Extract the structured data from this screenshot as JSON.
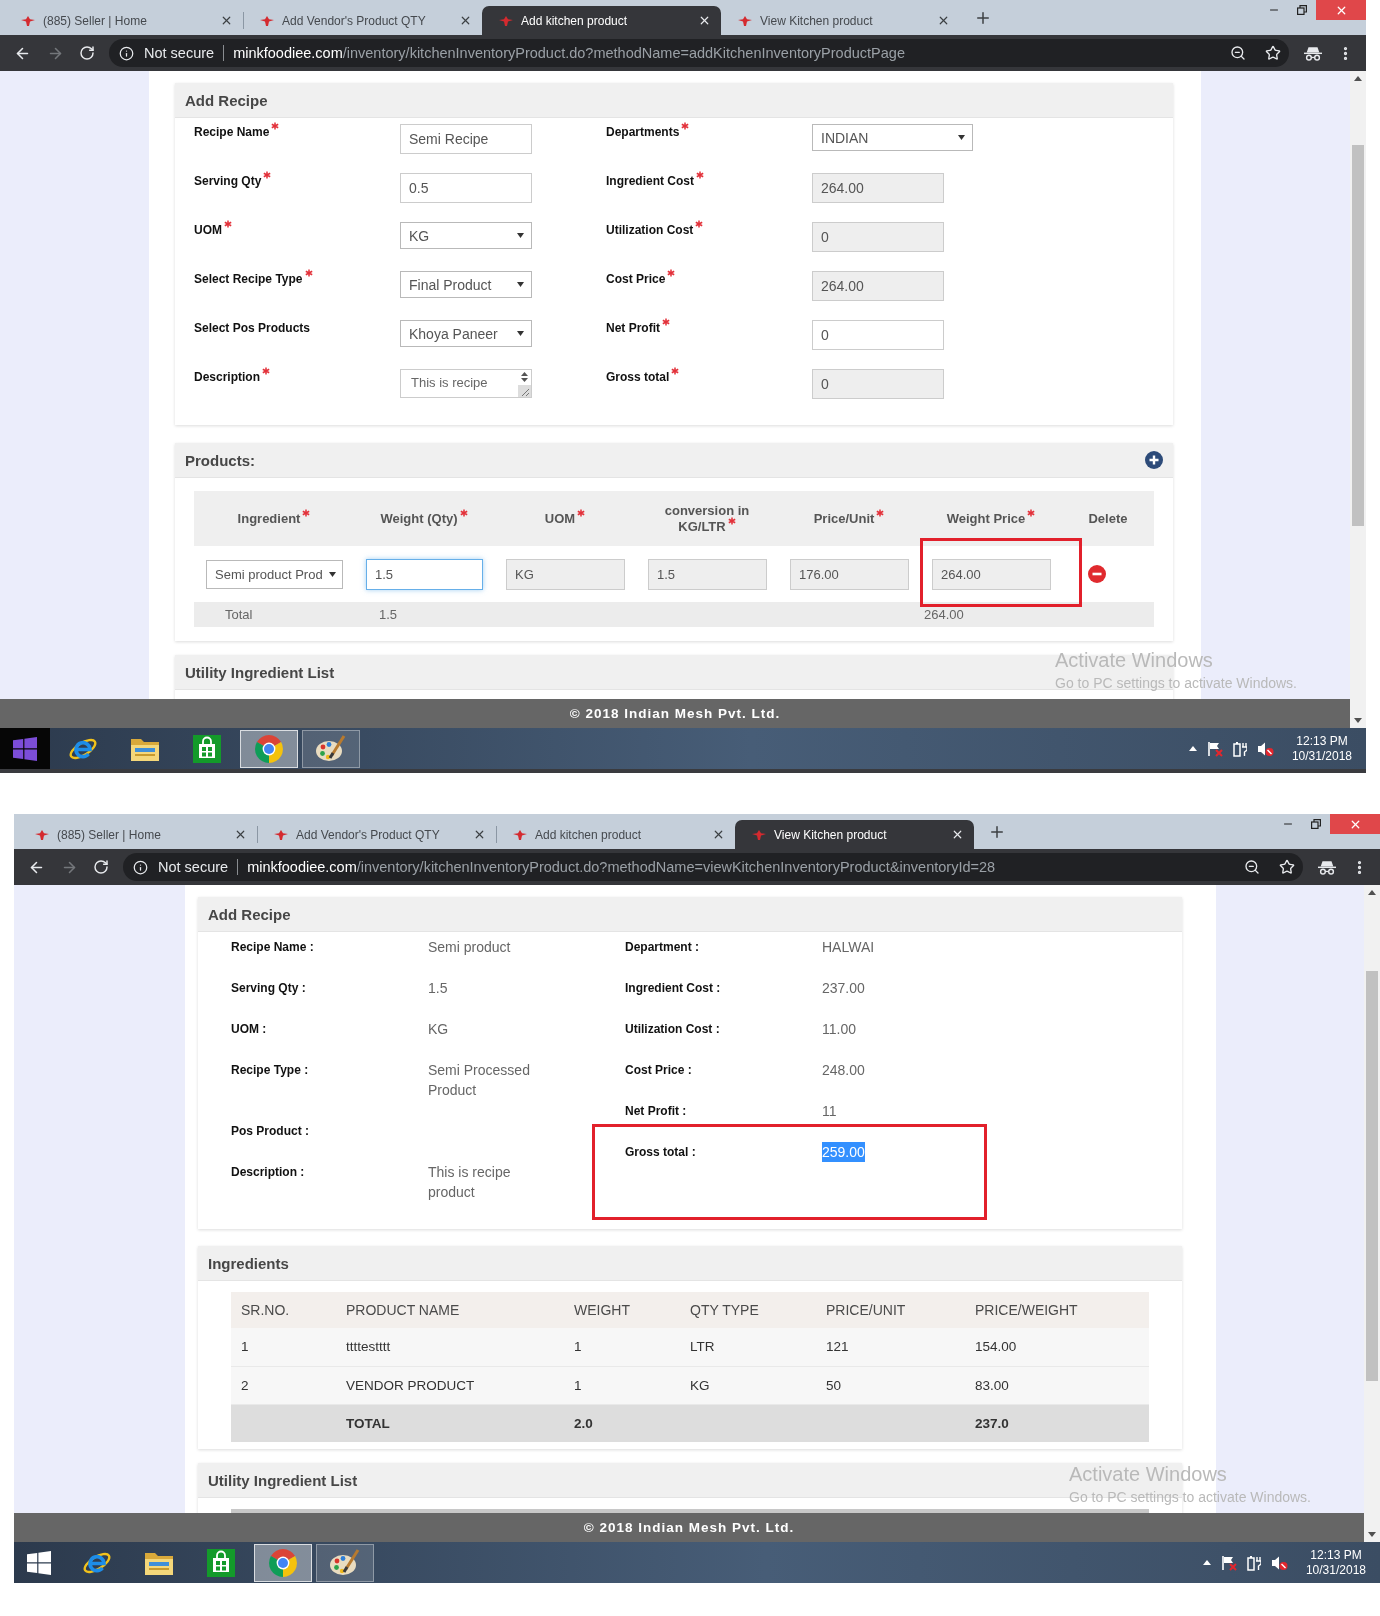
{
  "screens": [
    {
      "kind": "form",
      "tabs": [
        {
          "title": "(885) Seller | Home",
          "selected": false
        },
        {
          "title": "Add Vendor's Product QTY",
          "selected": false
        },
        {
          "title": "Add kitchen product",
          "selected": true
        },
        {
          "title": "View Kitchen product",
          "selected": false
        }
      ],
      "toolbar": {
        "forward_disabled": true,
        "security": "Not secure",
        "url": {
          "host": "minkfoodiee.com",
          "path": "/inventory/kitchenInventoryProduct.do?methodName=addKitchenInventoryProductPage"
        }
      },
      "page": {
        "recipe_form": {
          "title": "Add Recipe",
          "left_fields": [
            {
              "label": "Recipe Name",
              "required": true,
              "kind": "text",
              "value": "Semi Recipe"
            },
            {
              "label": "Serving Qty",
              "required": true,
              "kind": "text",
              "value": "0.5"
            },
            {
              "label": "UOM",
              "required": true,
              "kind": "select",
              "value": "KG"
            },
            {
              "label": "Select Recipe Type",
              "required": true,
              "kind": "select",
              "value": "Final Product"
            },
            {
              "label": "Select Pos Products",
              "required": false,
              "kind": "select",
              "value": "Khoya Paneer"
            },
            {
              "label": "Description",
              "required": true,
              "kind": "textarea",
              "value": "This is recipe"
            }
          ],
          "right_fields": [
            {
              "label": "Departments",
              "required": true,
              "kind": "select",
              "value": "INDIAN"
            },
            {
              "label": "Ingredient Cost",
              "required": true,
              "kind": "readonly",
              "value": "264.00"
            },
            {
              "label": "Utilization Cost",
              "required": true,
              "kind": "readonly",
              "value": "0"
            },
            {
              "label": "Cost Price",
              "required": true,
              "kind": "readonly",
              "value": "264.00"
            },
            {
              "label": "Net Profit",
              "required": true,
              "kind": "text",
              "value": "0"
            },
            {
              "label": "Gross total",
              "required": true,
              "kind": "readonly",
              "value": "0"
            }
          ]
        },
        "products": {
          "title": "Products:",
          "columns": [
            {
              "label": "Ingredient",
              "required": true
            },
            {
              "label": "Weight (Qty)",
              "required": true
            },
            {
              "label": "UOM",
              "required": true
            },
            {
              "label": "conversion in KG/LTR",
              "required": true
            },
            {
              "label": "Price/Unit",
              "required": true
            },
            {
              "label": "Weight Price",
              "required": true
            },
            {
              "label": "Delete",
              "required": false
            }
          ],
          "rows": [
            {
              "cells": [
                {
                  "kind": "select",
                  "value": "Semi product Prod",
                  "focused": false,
                  "highlighted": false
                },
                {
                  "kind": "text",
                  "value": "1.5",
                  "focused": true,
                  "highlighted": false
                },
                {
                  "kind": "readonly",
                  "value": "KG",
                  "focused": false,
                  "highlighted": false
                },
                {
                  "kind": "readonly",
                  "value": "1.5",
                  "focused": false,
                  "highlighted": false
                },
                {
                  "kind": "readonly",
                  "value": "176.00",
                  "focused": false,
                  "highlighted": false
                },
                {
                  "kind": "readonly",
                  "value": "264.00",
                  "focused": false,
                  "highlighted": true
                },
                {
                  "kind": "delete"
                }
              ]
            }
          ],
          "total": {
            "label": "Total",
            "weight": "1.5",
            "weight_price": "264.00"
          }
        },
        "utility": {
          "title": "Utility Ingredient List"
        }
      },
      "footer": "© 2018 Indian Mesh Pvt. Ltd.",
      "os_notice": {
        "title": "Activate Windows",
        "message": "Go to PC settings to activate Windows."
      },
      "taskbar": {
        "start_highlighted": true,
        "apps": [
          {
            "kind": "e-logo",
            "selected": false,
            "running": false
          },
          {
            "kind": "folder",
            "selected": false,
            "running": false
          },
          {
            "kind": "bag",
            "selected": false,
            "running": false
          },
          {
            "kind": "wheel",
            "selected": true,
            "running": true
          },
          {
            "kind": "palette",
            "selected": false,
            "running": true
          }
        ],
        "time": "12:13 PM",
        "date": "10/31/2018"
      }
    },
    {
      "kind": "view",
      "tabs": [
        {
          "title": "(885) Seller | Home",
          "selected": false
        },
        {
          "title": "Add Vendor's Product QTY",
          "selected": false
        },
        {
          "title": "Add kitchen product",
          "selected": false
        },
        {
          "title": "View Kitchen product",
          "selected": true
        }
      ],
      "toolbar": {
        "forward_disabled": true,
        "security": "Not secure",
        "url": {
          "host": "minkfoodiee.com",
          "path": "/inventory/kitchenInventoryProduct.do?methodName=viewKitchenInventoryProduct&inventoryId=28"
        }
      },
      "page": {
        "details": {
          "title": "Add Recipe",
          "left": [
            {
              "label": "Recipe Name :",
              "value": "Semi product",
              "highlighted": false,
              "text_selected": false
            },
            {
              "label": "Serving Qty :",
              "value": "1.5",
              "highlighted": false,
              "text_selected": false
            },
            {
              "label": "UOM :",
              "value": "KG",
              "highlighted": false,
              "text_selected": false
            },
            {
              "label": "Recipe Type :",
              "value": "Semi Processed Product",
              "highlighted": false,
              "text_selected": false
            },
            {
              "label": "Pos Product :",
              "highlighted": false
            },
            {
              "label": "Description :",
              "value": "This is recipe product",
              "highlighted": false,
              "text_selected": false
            }
          ],
          "right": [
            {
              "label": "Department :",
              "value": "HALWAI",
              "highlighted": false,
              "text_selected": false
            },
            {
              "label": "Ingredient Cost :",
              "value": "237.00",
              "highlighted": false,
              "text_selected": false
            },
            {
              "label": "Utilization Cost :",
              "value": "11.00",
              "highlighted": false,
              "text_selected": false
            },
            {
              "label": "Cost Price :",
              "value": "248.00",
              "highlighted": false,
              "text_selected": false
            },
            {
              "label": "Net Profit :",
              "value": "11",
              "highlighted": false,
              "text_selected": false
            },
            {
              "label": "Gross total :",
              "value": "259.00",
              "highlighted": true,
              "text_selected": true
            }
          ]
        },
        "ingredients": {
          "title": "Ingredients",
          "columns": [
            "SR.NO.",
            "PRODUCT NAME",
            "WEIGHT",
            "QTY TYPE",
            "PRICE/UNIT",
            "PRICE/WEIGHT"
          ],
          "rows": [
            [
              "1",
              "ttttestttt",
              "1",
              "LTR",
              "121",
              "154.00"
            ],
            [
              "2",
              "VENDOR PRODUCT",
              "1",
              "KG",
              "50",
              "83.00"
            ]
          ],
          "total": {
            "label": "TOTAL",
            "weight": "2.0",
            "price_weight": "237.0"
          }
        },
        "utility": {
          "title": "Utility Ingredient List"
        }
      },
      "footer": "© 2018 Indian Mesh Pvt. Ltd.",
      "os_notice": {
        "title": "Activate Windows",
        "message": "Go to PC settings to activate Windows."
      },
      "taskbar": {
        "start_highlighted": false,
        "apps": [
          {
            "kind": "e-logo",
            "selected": false,
            "running": false
          },
          {
            "kind": "folder",
            "selected": false,
            "running": false
          },
          {
            "kind": "bag",
            "selected": false,
            "running": false
          },
          {
            "kind": "wheel",
            "selected": true,
            "running": true
          },
          {
            "kind": "palette",
            "selected": false,
            "running": true
          }
        ],
        "time": "12:13 PM",
        "date": "10/31/2018"
      }
    }
  ]
}
